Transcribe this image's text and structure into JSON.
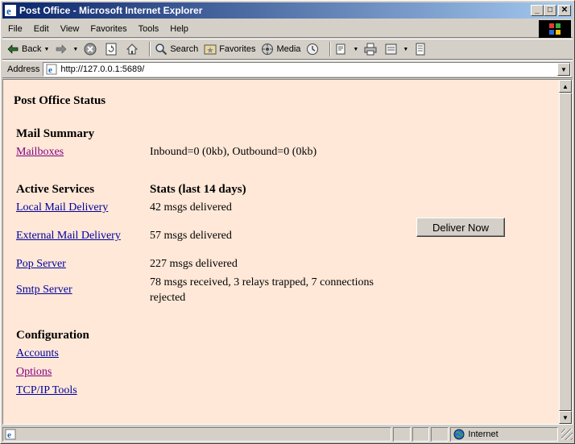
{
  "window": {
    "title": "Post Office - Microsoft Internet Explorer",
    "minimize": "_",
    "maximize": "□",
    "close": "✕"
  },
  "menu": [
    "File",
    "Edit",
    "View",
    "Favorites",
    "Tools",
    "Help"
  ],
  "toolbar": {
    "back": "Back",
    "search": "Search",
    "favorites": "Favorites",
    "media": "Media"
  },
  "address": {
    "label": "Address",
    "url": "http://127.0.0.1:5689/"
  },
  "page": {
    "title": "Post Office Status",
    "mail_summary": {
      "heading": "Mail Summary",
      "link": "Mailboxes",
      "value": "Inbound=0 (0kb), Outbound=0 (0kb)"
    },
    "services": {
      "heading": "Active Services",
      "stats_heading": "Stats (last 14 days)",
      "rows": [
        {
          "name": "Local Mail Delivery",
          "stat": "42 msgs delivered"
        },
        {
          "name": "External Mail Delivery",
          "stat": "57 msgs delivered"
        },
        {
          "name": "Pop Server",
          "stat": "227 msgs delivered"
        },
        {
          "name": "Smtp Server",
          "stat_line1": "78 msgs received, 3 relays trapped, 7 connections",
          "stat_line2": "rejected"
        }
      ],
      "deliver_button": "Deliver Now"
    },
    "configuration": {
      "heading": "Configuration",
      "links": [
        "Accounts",
        "Options",
        "TCP/IP Tools"
      ]
    }
  },
  "status": {
    "zone": "Internet"
  },
  "colors": {
    "page_background": "#ffe8d8",
    "link": "#00009c",
    "visited_link": "#800080",
    "titlebar_start": "#0a246a"
  }
}
